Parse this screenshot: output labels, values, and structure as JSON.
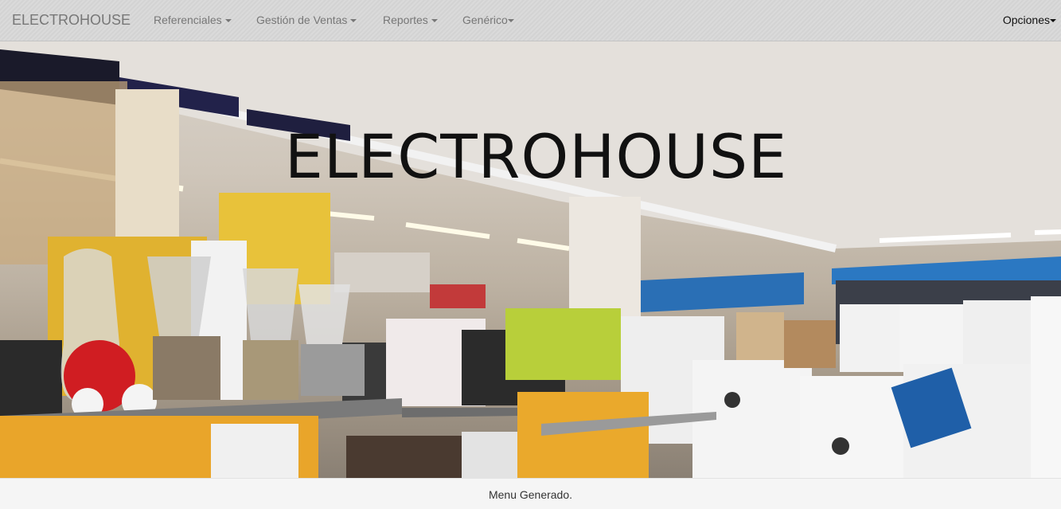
{
  "navbar": {
    "brand": "ELECTROHOUSE",
    "menus": [
      {
        "label": "Referenciales"
      },
      {
        "label": "Gestión de Ventas"
      },
      {
        "label": "Reportes"
      },
      {
        "label": "Genérico"
      }
    ],
    "options_label": "Opciones"
  },
  "hero": {
    "title": "ELECTROHOUSE"
  },
  "footer": {
    "text": "Menu Generado."
  },
  "icons": [
    "caret-down-icon"
  ],
  "colors": {
    "navbar_bg": "#d6d6d6",
    "nav_text": "#777777",
    "footer_bg": "#f5f5f5",
    "hero_title": "#111111"
  }
}
